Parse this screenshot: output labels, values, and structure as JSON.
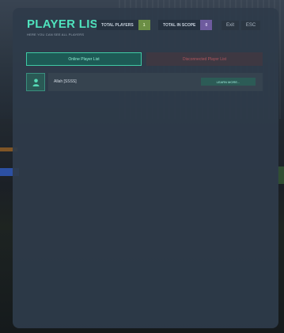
{
  "header": {
    "title": "PLAYER LIST",
    "subtitle": "HERE YOU CAN SEE ALL PLAYERS"
  },
  "stats": {
    "total_players": {
      "label": "TOTAL PLAYERS",
      "value": "1"
    },
    "total_in_scope": {
      "label": "TOTAL IN SCOPE",
      "value": "0"
    }
  },
  "controls": {
    "exit_label": "Exit",
    "esc_label": "ESC"
  },
  "tabs": [
    {
      "label": "Online Player List",
      "active": true
    },
    {
      "label": "Disconnected Player List",
      "active": false
    }
  ],
  "players": [
    {
      "name": "Allah [SSSS]",
      "action_label": "LEARN MORE..."
    }
  ],
  "colors": {
    "accent": "#4fe3bd",
    "panel": "#2e3b4a",
    "total_badge": "#6b8e45",
    "scope_badge": "#6e5b9e",
    "disconnected_text": "#b2565e"
  },
  "icons": {
    "avatar": "user-icon"
  }
}
